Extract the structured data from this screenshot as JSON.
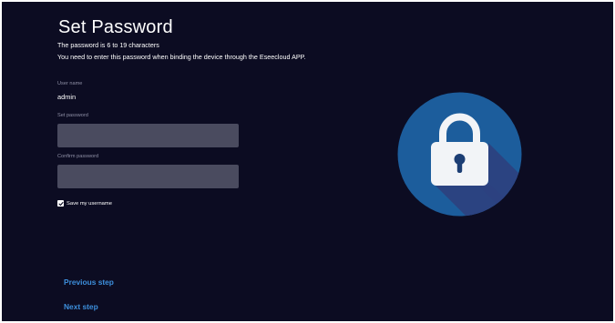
{
  "page": {
    "title": "Set Password",
    "description_lines": [
      "The password is 6 to 19 characters",
      "You need to enter this password when binding the device through the Eseecloud APP."
    ]
  },
  "form": {
    "username_label": "User name",
    "username_value": "admin",
    "set_password_label": "Set password",
    "set_password_value": "",
    "confirm_password_label": "Confirm password",
    "confirm_password_value": "",
    "save_username_label": "Save my username",
    "save_username_checked": true
  },
  "navigation": {
    "previous_label": "Previous step",
    "next_label": "Next step"
  },
  "illustration": {
    "icon": "lock-icon"
  },
  "colors": {
    "background": "#0c0c22",
    "input_fill": "#4a4b5f",
    "link": "#3d8fdc",
    "lock_circle": "#1c5d9c",
    "lock_shadow": "#2c4180"
  }
}
